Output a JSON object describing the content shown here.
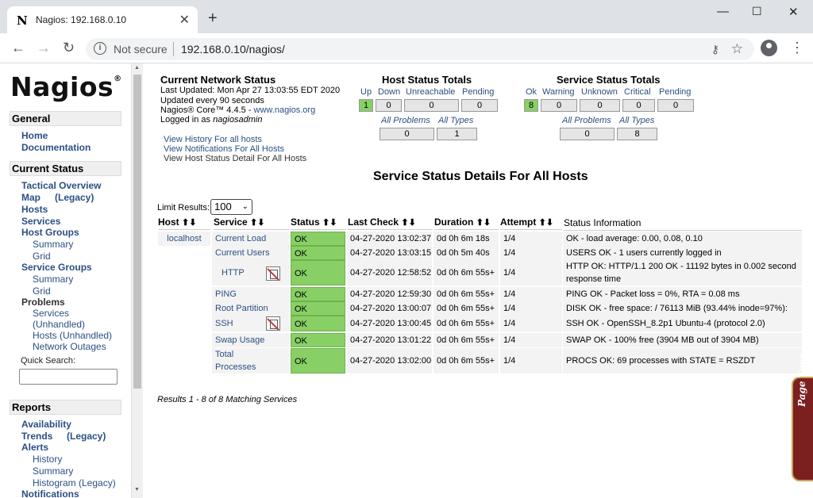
{
  "browser": {
    "tab_title": "Nagios: 192.168.0.10",
    "tab_icon": "N",
    "security": "Not secure",
    "url": "192.168.0.10/nagios/"
  },
  "sidebar": {
    "logo": "Nagios",
    "logo_mark": "®",
    "general": {
      "heading": "General",
      "home": "Home",
      "documentation": "Documentation"
    },
    "current_status": {
      "heading": "Current Status",
      "tactical": "Tactical Overview",
      "map": "Map",
      "map_legacy": "(Legacy)",
      "hosts": "Hosts",
      "services": "Services",
      "host_groups": "Host Groups",
      "hg_summary": "Summary",
      "hg_grid": "Grid",
      "service_groups": "Service Groups",
      "sg_summary": "Summary",
      "sg_grid": "Grid",
      "problems": "Problems",
      "p_services": "Services",
      "p_unhandled": "(Unhandled)",
      "p_hosts": "Hosts (Unhandled)",
      "p_outages": "Network Outages"
    },
    "quick_search": "Quick Search:",
    "reports": {
      "heading": "Reports",
      "availability": "Availability",
      "trends": "Trends",
      "trends_legacy": "(Legacy)",
      "alerts": "Alerts",
      "history": "History",
      "summary": "Summary",
      "histogram": "Histogram (Legacy)",
      "notifications": "Notifications"
    }
  },
  "status": {
    "title": "Current Network Status",
    "last_updated": "Last Updated: Mon Apr 27 13:03:55 EDT 2020",
    "updated_every": "Updated every 90 seconds",
    "core_prefix": "Nagios® Core™ 4.4.5 - ",
    "core_link": "www.nagios.org",
    "logged_prefix": "Logged in as ",
    "logged_user": "nagiosadmin",
    "links": [
      "View History For all hosts",
      "View Notifications For All Hosts",
      "View Host Status Detail For All Hosts"
    ]
  },
  "host_totals": {
    "title": "Host Status Totals",
    "labels": [
      "Up",
      "Down",
      "Unreachable",
      "Pending"
    ],
    "values": [
      "1",
      "0",
      "0",
      "0"
    ],
    "all_problems": "All Problems",
    "all_types": "All Types",
    "problems_value": "0",
    "types_value": "1"
  },
  "service_totals": {
    "title": "Service Status Totals",
    "labels": [
      "Ok",
      "Warning",
      "Unknown",
      "Critical",
      "Pending"
    ],
    "values": [
      "8",
      "0",
      "0",
      "0",
      "0"
    ],
    "all_problems": "All Problems",
    "all_types": "All Types",
    "problems_value": "0",
    "types_value": "8"
  },
  "details": {
    "title": "Service Status Details For All Hosts",
    "limit_label": "Limit Results:",
    "limit_value": "100",
    "columns": [
      "Host",
      "Service",
      "Status",
      "Last Check",
      "Duration",
      "Attempt",
      "Status Information"
    ],
    "host": "localhost",
    "rows": [
      {
        "service": "Current Load",
        "status": "OK",
        "last_check": "04-27-2020 13:02:37",
        "duration": "0d 0h 6m 18s",
        "attempt": "1/4",
        "info": "OK - load average: 0.00, 0.08, 0.10"
      },
      {
        "service": "Current Users",
        "status": "OK",
        "last_check": "04-27-2020 13:03:15",
        "duration": "0d 0h 5m 40s",
        "attempt": "1/4",
        "info": "USERS OK - 1 users currently logged in"
      },
      {
        "service": "HTTP",
        "status": "OK",
        "last_check": "04-27-2020 12:58:52",
        "duration": "0d 0h 6m 55s+",
        "attempt": "1/4",
        "info": "HTTP OK: HTTP/1.1 200 OK - 11192 bytes in 0.002 second",
        "info2": "response time"
      },
      {
        "service": "PING",
        "status": "OK",
        "last_check": "04-27-2020 12:59:30",
        "duration": "0d 0h 6m 55s+",
        "attempt": "1/4",
        "info": "PING OK - Packet loss = 0%, RTA = 0.08 ms"
      },
      {
        "service": "Root Partition",
        "status": "OK",
        "last_check": "04-27-2020 13:00:07",
        "duration": "0d 0h 6m 55s+",
        "attempt": "1/4",
        "info": "DISK OK - free space: / 76113 MiB (93.44% inode=97%):"
      },
      {
        "service": "SSH",
        "status": "OK",
        "last_check": "04-27-2020 13:00:45",
        "duration": "0d 0h 6m 55s+",
        "attempt": "1/4",
        "info": "SSH OK - OpenSSH_8.2p1 Ubuntu-4 (protocol 2.0)"
      },
      {
        "service": "Swap Usage",
        "status": "OK",
        "last_check": "04-27-2020 13:01:22",
        "duration": "0d 0h 6m 55s+",
        "attempt": "1/4",
        "info": "SWAP OK - 100% free (3904 MB out of 3904 MB)"
      },
      {
        "service": "Total",
        "service2": "Processes",
        "status": "OK",
        "last_check": "04-27-2020 13:02:00",
        "duration": "0d 0h 6m 55s+",
        "attempt": "1/4",
        "info": "PROCS OK: 69 processes with STATE = RSZDT"
      }
    ],
    "results": "Results 1 - 8 of 8 Matching Services"
  },
  "page_tour": "Page Tour"
}
